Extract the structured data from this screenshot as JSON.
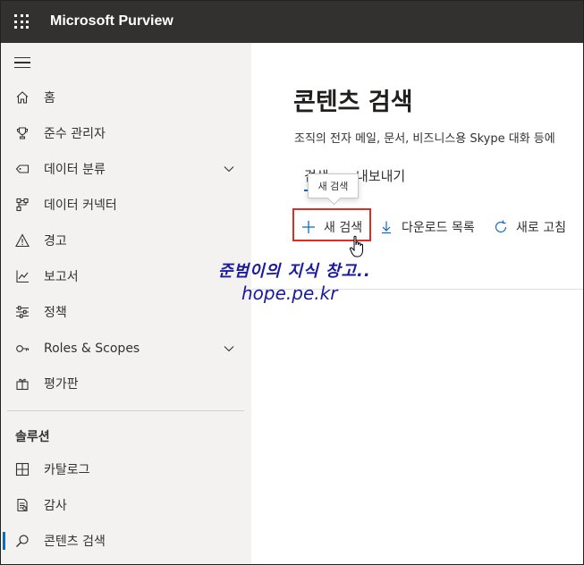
{
  "app": {
    "title": "Microsoft Purview"
  },
  "icons": {
    "app_launcher": "waffle-grid-icon",
    "menu": "hamburger-icon"
  },
  "sidebar": {
    "items": [
      {
        "label": "홈",
        "icon": "home-icon"
      },
      {
        "label": "준수 관리자",
        "icon": "trophy-icon"
      },
      {
        "label": "데이터 분류",
        "icon": "tag-icon",
        "expandable": true
      },
      {
        "label": "데이터 커넥터",
        "icon": "connector-icon"
      },
      {
        "label": "경고",
        "icon": "warning-icon"
      },
      {
        "label": "보고서",
        "icon": "chart-icon"
      },
      {
        "label": "정책",
        "icon": "sliders-icon"
      },
      {
        "label": "Roles & Scopes",
        "icon": "key-icon",
        "expandable": true
      },
      {
        "label": "평가판",
        "icon": "gift-icon"
      }
    ],
    "section_label": "솔루션",
    "solutions": [
      {
        "label": "카탈로그",
        "icon": "catalog-icon"
      },
      {
        "label": "감사",
        "icon": "audit-icon"
      },
      {
        "label": "콘텐츠 검색",
        "icon": "search-icon",
        "active": true
      }
    ]
  },
  "main": {
    "title": "콘텐츠 검색",
    "description": "조직의 전자 메일, 문서, 비즈니스용 Skype 대화 등에",
    "tabs": [
      {
        "label": "검색"
      },
      {
        "label": "내보내기"
      }
    ],
    "tooltip": "새 검색",
    "commands": [
      {
        "label": "새 검색",
        "icon": "plus-icon"
      },
      {
        "label": "다운로드 목록",
        "icon": "download-icon"
      },
      {
        "label": "새로 고침",
        "icon": "refresh-icon"
      }
    ]
  },
  "watermark": {
    "line1": "준범이의 지식 창고..",
    "line2": "hope.pe.kr"
  },
  "colors": {
    "topbar": "#323130",
    "sidebar": "#f3f2f1",
    "accent": "#0f6cbd",
    "highlight": "#d93025",
    "watermark": "#1a1aa0"
  }
}
